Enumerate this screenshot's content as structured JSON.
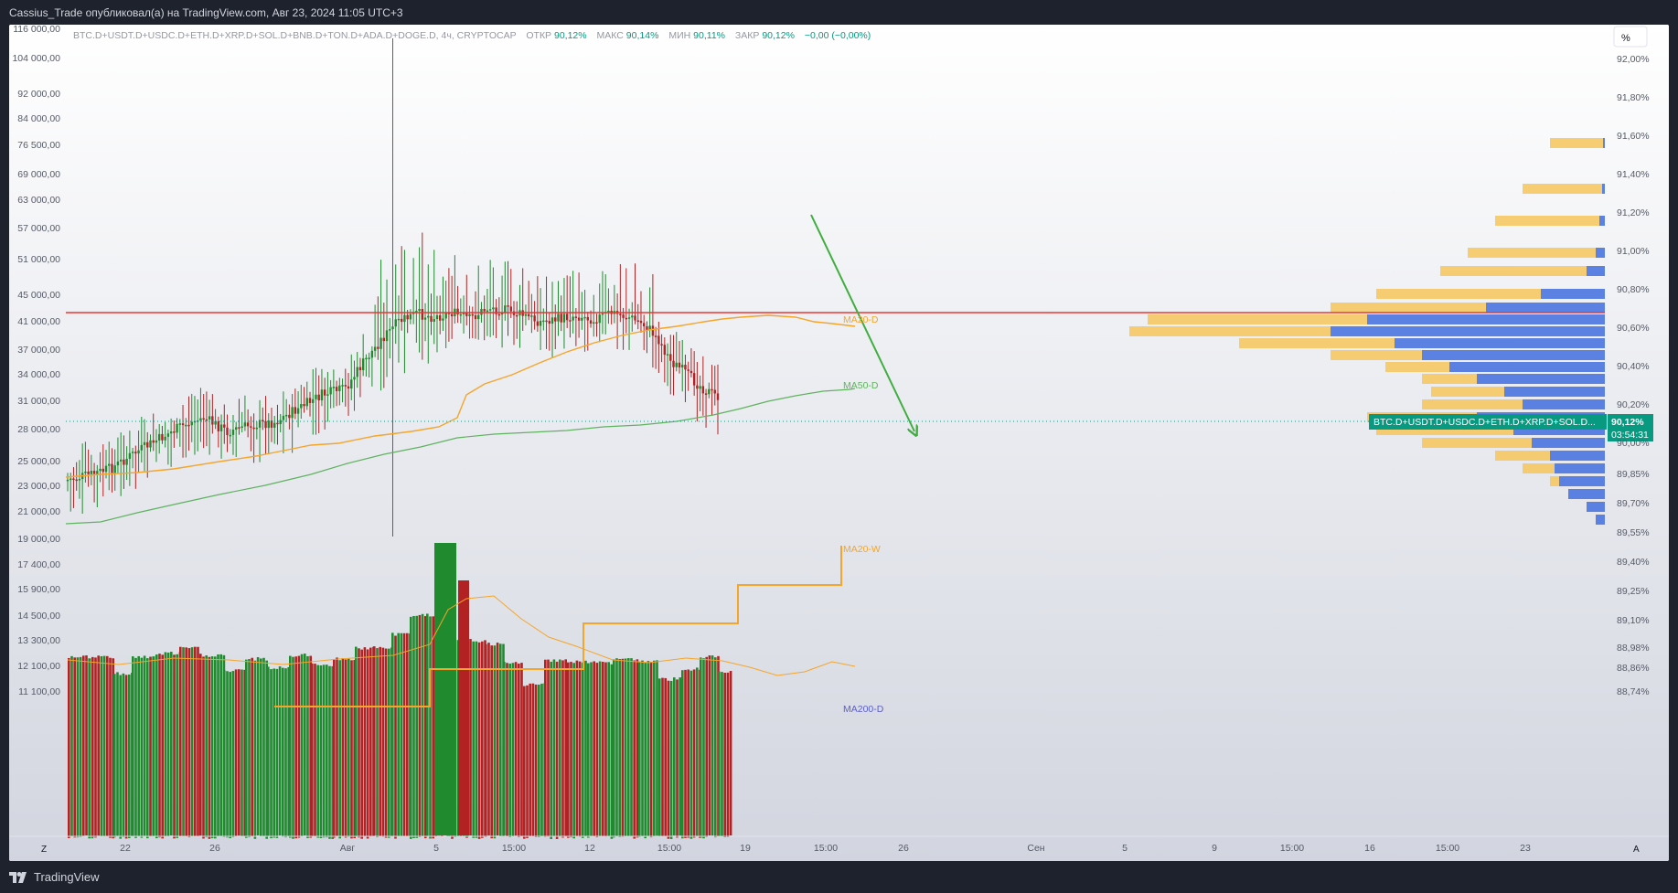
{
  "header": {
    "published_text": "Cassius_Trade опубликовал(а) на TradingView.com, Авг 23, 2024 11:05 UTC+3"
  },
  "footer": {
    "brand": "TradingView"
  },
  "legend": {
    "symbol": "BTC.D+USDT.D+USDC.D+ETH.D+XRP.D+SOL.D+BNB.D+TON.D+ADA.D+DOGE.D, 4ч, CRYPTOCAP",
    "open_label": "ОТКР",
    "open_value": "90,12%",
    "high_label": "МАКС",
    "high_value": "90,14%",
    "low_label": "МИН",
    "low_value": "90,11%",
    "close_label": "ЗАКР",
    "close_value": "90,12%",
    "change": "−0,00 (−0,00%)"
  },
  "controls": {
    "scale_button": "%",
    "zoom_toggle": "Z",
    "auto_toggle": "A"
  },
  "colors": {
    "up": "#1f8a2e",
    "down": "#b22222",
    "ma_orange": "#f5a52a",
    "ma_green": "#5fb35f",
    "resistance": "#e53935",
    "arrow": "#3fae3f",
    "vp_up": "#f7c65c",
    "vp_down": "#4a74e0",
    "price_badge": "#089981"
  },
  "chart_data": {
    "type": "candlestick",
    "symbol": "BTC.D+USDT.D+USDC.D+ETH.D+XRP.D+SOL.D+BNB.D+TON.D+ADA.D+DOGE.D",
    "timeframe": "4ч",
    "right_axis": {
      "ticks": [
        "92,00%",
        "91,80%",
        "91,60%",
        "91,40%",
        "91,20%",
        "91,00%",
        "90,80%",
        "90,60%",
        "90,40%",
        "90,20%",
        "90,00%",
        "89,85%",
        "89,70%",
        "89,55%",
        "89,40%",
        "89,25%",
        "89,10%",
        "88,98%",
        "88,86%",
        "88,74%"
      ],
      "current_price": "90,12%",
      "current_label": "BTC.D+USDT.D+USDC.D+ETH.D+XRP.D+SOL.D...",
      "countdown": "03:54:31"
    },
    "left_axis": {
      "ticks": [
        "116 000,00",
        "104 000,00",
        "92 000,00",
        "84 000,00",
        "76 500,00",
        "69 000,00",
        "63 000,00",
        "57 000,00",
        "51 000,00",
        "45 000,00",
        "41 000,00",
        "37 000,00",
        "34 000,00",
        "31 000,00",
        "28 000,00",
        "25 000,00",
        "23 000,00",
        "21 000,00",
        "19 000,00",
        "17 400,00",
        "15 900,00",
        "14 500,00",
        "13 300,00",
        "12 100,00",
        "11 100,00"
      ]
    },
    "x_axis": {
      "ticks": [
        "22",
        "26",
        "Авг",
        "5",
        "15:00",
        "12",
        "15:00",
        "19",
        "15:00",
        "26",
        "Сен",
        "5",
        "9",
        "15:00",
        "16",
        "15:00",
        "23"
      ]
    },
    "indicators": [
      "MA20-D",
      "MA50-D",
      "MA20-W",
      "MA200-D"
    ],
    "resistance_level": "90,68%"
  }
}
